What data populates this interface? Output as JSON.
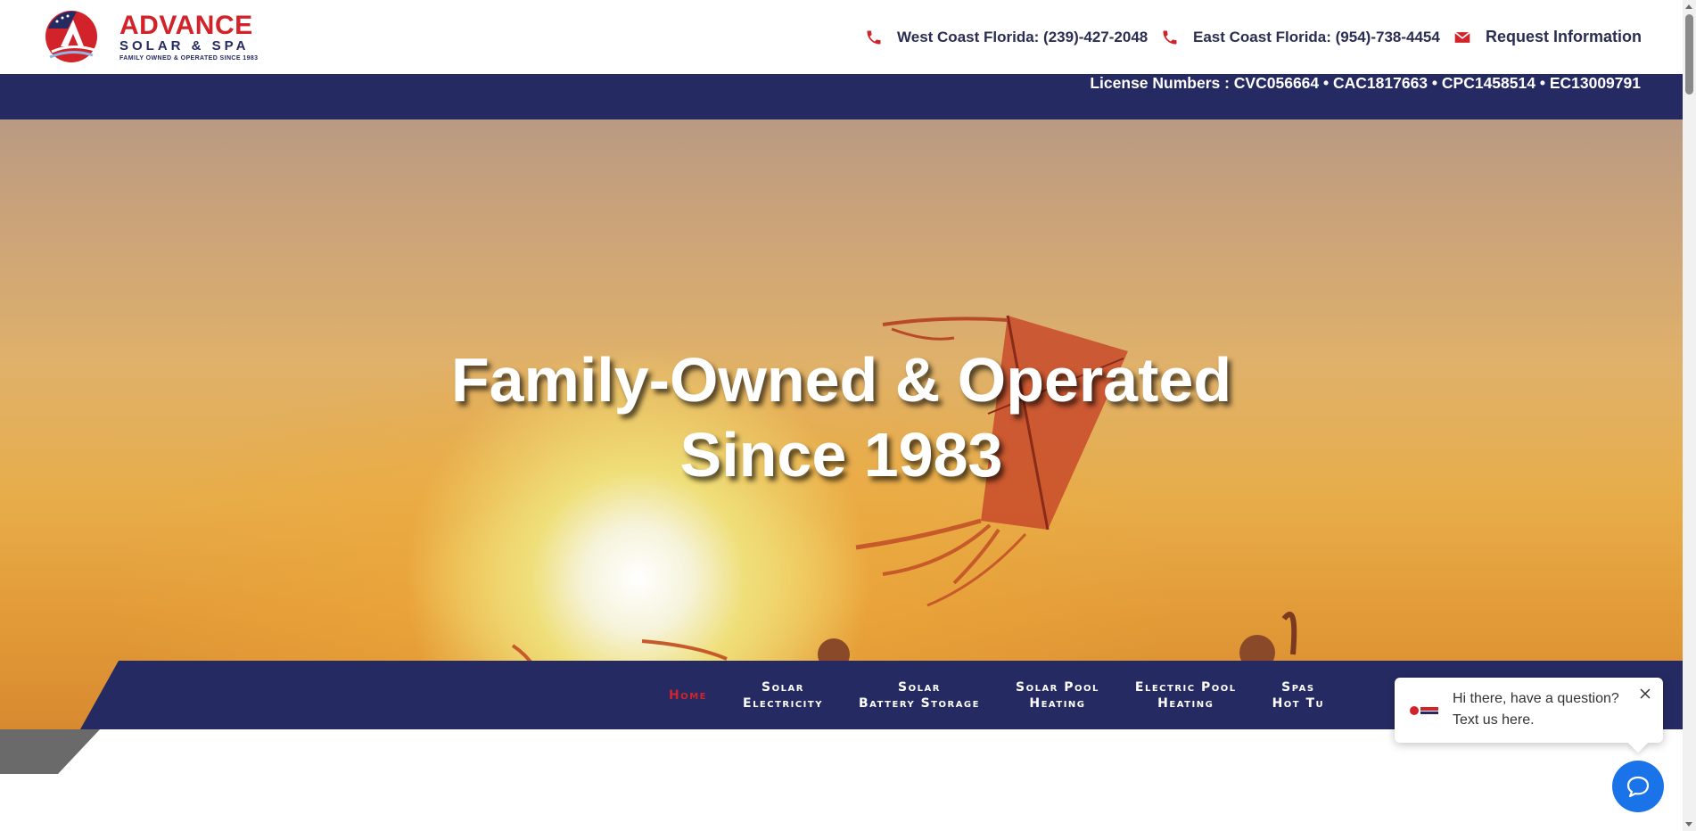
{
  "brand": {
    "name": "ADVANCE",
    "sub": "SOLAR & SPA",
    "tagline": "FAMILY OWNED & OPERATED SINCE 1983",
    "colors": {
      "navy": "#252a62",
      "red": "#d2232a",
      "chat_blue": "#1a73e8"
    }
  },
  "header": {
    "west": {
      "icon": "phone-icon",
      "label": "West Coast Florida: (239)-427-2048"
    },
    "east": {
      "icon": "phone-icon",
      "label": "East Coast Florida: (954)-738-4454"
    },
    "request": {
      "icon": "envelope-icon",
      "label": "Request Information"
    }
  },
  "license_bar": {
    "text": "License Numbers : CVC056664 • CAC1817663 • CPC1458514 • EC13009791"
  },
  "hero": {
    "title_line1": "Family-Owned & Operated",
    "title_line2": "Since 1983"
  },
  "nav": {
    "items": [
      {
        "line1": "Home",
        "line2": "",
        "active": true
      },
      {
        "line1": "Solar",
        "line2": "Electricity",
        "active": false
      },
      {
        "line1": "Solar",
        "line2": "Battery Storage",
        "active": false
      },
      {
        "line1": "Solar Pool",
        "line2": "Heating",
        "active": false
      },
      {
        "line1": "Electric Pool",
        "line2": "Heating",
        "active": false
      },
      {
        "line1": "Spas",
        "line2": "Hot Tu",
        "active": false
      }
    ]
  },
  "chat": {
    "message": "Hi there, have a question? Text us here.",
    "close_icon": "close-icon",
    "button_icon": "chat-bubble-icon"
  }
}
